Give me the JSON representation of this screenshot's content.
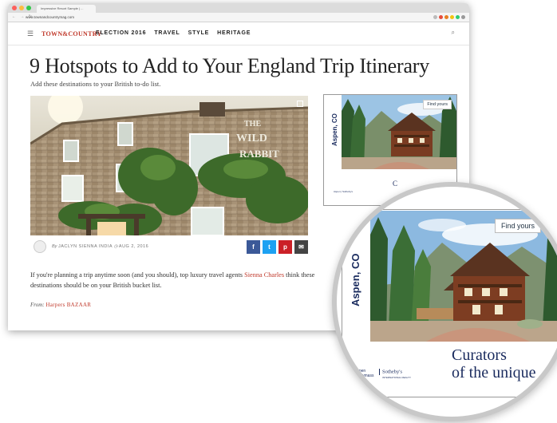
{
  "browser": {
    "tab_title": "Impressive Resort Sample | ...",
    "url": "www.townandcountrymag.com",
    "nav_glyphs": "← → ↻"
  },
  "site": {
    "logo": "TOWN&COUNTRY",
    "nav": [
      "ELECTION 2016",
      "TRAVEL",
      "STYLE",
      "HERITAGE"
    ]
  },
  "article": {
    "headline": "9 Hotspots to Add to Your England Trip Itinerary",
    "deck": "Add these destinations to your British to-do list.",
    "image_sign_line1": "THE",
    "image_sign_line2": "WILD",
    "image_sign_line3": "RABBIT",
    "byline_prefix": "By",
    "author": "JACLYN SIENNA INDIA",
    "date_icon": "◷",
    "date": "AUG 2, 2016",
    "share": {
      "facebook": "f",
      "twitter": "t",
      "pinterest": "p",
      "email": "✉"
    },
    "body_part1": "If you're planning a trip anytime soon (and you should), top luxury travel agents",
    "body_link": "Sienna Charles",
    "body_part2": " think these destinations should be on your British bucket list.",
    "from_label": "From:",
    "from_source": "Harpers BAZAAR"
  },
  "ad": {
    "location": "Aspen, CO",
    "cta": "Find yours",
    "brand_left_line1": "Aspen",
    "brand_left_line2": "Snowmass",
    "brand_right_line1": "Sotheby's",
    "brand_right_line2": "INTERNATIONAL REALTY",
    "tagline_line1": "Curators",
    "tagline_line2": "of the unique",
    "tagline_small": "C"
  },
  "colors": {
    "brand_red": "#c0392b",
    "facebook": "#3b5998",
    "twitter": "#1da1f2",
    "pinterest": "#cb2027",
    "email": "#444444",
    "sothebys_navy": "#1a2b5e"
  }
}
